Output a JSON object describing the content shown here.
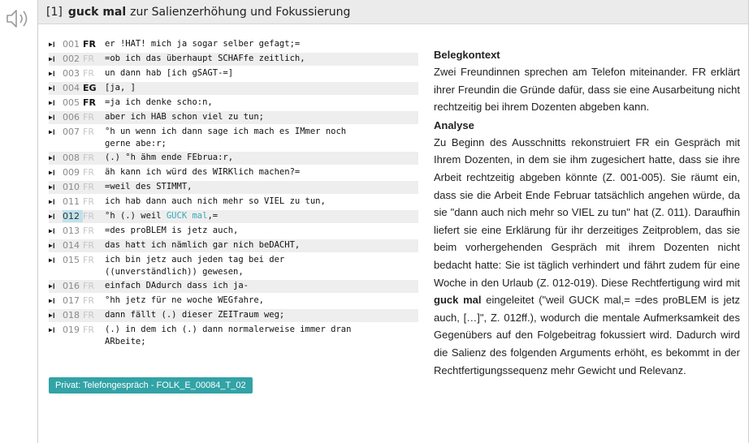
{
  "header": {
    "number": "[1]",
    "phrase": "guck mal",
    "title": "zur Salienzerhöhung und Fokussierung"
  },
  "transcript": [
    {
      "num": "001",
      "speaker": "FR",
      "strong": true,
      "text": "er !HAT! mich ja sogar selber gefagt;=",
      "alt": false
    },
    {
      "num": "002",
      "speaker": "FR",
      "strong": false,
      "text": "=ob ich das überhaupt SCHAFfe zeitlich,",
      "alt": true
    },
    {
      "num": "003",
      "speaker": "FR",
      "strong": false,
      "text": "un dann hab [ich gSAGT-=]",
      "alt": false
    },
    {
      "num": "004",
      "speaker": "EG",
      "strong": true,
      "text": "[ja, ]",
      "alt": true
    },
    {
      "num": "005",
      "speaker": "FR",
      "strong": true,
      "text": "=ja ich denke scho:n,",
      "alt": false
    },
    {
      "num": "006",
      "speaker": "FR",
      "strong": false,
      "text": "aber ich HAB schon viel zu tun;",
      "alt": true
    },
    {
      "num": "007",
      "speaker": "FR",
      "strong": false,
      "text": "°h un wenn ich dann sage ich mach es IMmer noch\ngerne abe:r;",
      "alt": false
    },
    {
      "num": "008",
      "speaker": "FR",
      "strong": false,
      "text": "(.) °h ähm ende FEbrua:r,",
      "alt": true
    },
    {
      "num": "009",
      "speaker": "FR",
      "strong": false,
      "text": "äh kann ich würd des WIRKlich machen?=",
      "alt": false
    },
    {
      "num": "010",
      "speaker": "FR",
      "strong": false,
      "text": "=weil des STIMMT,",
      "alt": true
    },
    {
      "num": "011",
      "speaker": "FR",
      "strong": false,
      "text": "ich hab dann auch nich mehr so VIEL zu tun,",
      "alt": false
    },
    {
      "num": "012",
      "speaker": "FR",
      "strong": false,
      "text": "°h (.) weil ",
      "mark": "GUCK mal",
      "after": ",=",
      "alt": true,
      "highlight": true
    },
    {
      "num": "013",
      "speaker": "FR",
      "strong": false,
      "text": "=des proBLEM is jetz auch,",
      "alt": false
    },
    {
      "num": "014",
      "speaker": "FR",
      "strong": false,
      "text": "das hatt ich nämlich gar nich beDACHT,",
      "alt": true
    },
    {
      "num": "015",
      "speaker": "FR",
      "strong": false,
      "text": "ich bin jetz auch jeden tag bei der\n((unverständlich)) gewesen,",
      "alt": false
    },
    {
      "num": "016",
      "speaker": "FR",
      "strong": false,
      "text": "einfach DAdurch dass ich ja-",
      "alt": true
    },
    {
      "num": "017",
      "speaker": "FR",
      "strong": false,
      "text": "°hh jetz für ne woche WEGfahre,",
      "alt": false
    },
    {
      "num": "018",
      "speaker": "FR",
      "strong": false,
      "text": "dann fällt (.) dieser ZEITraum weg;",
      "alt": true
    },
    {
      "num": "019",
      "speaker": "FR",
      "strong": false,
      "text": "(.) in dem ich (.) dann normalerweise immer dran\nARbeite;",
      "alt": false
    }
  ],
  "badge": "Privat: Telefongespräch - FOLK_E_00084_T_02",
  "belegkontext": {
    "heading": "Belegkontext",
    "text": "Zwei Freundinnen sprechen am Telefon miteinander. FR erklärt ihrer Freundin die Gründe dafür, dass sie eine Ausarbeitung nicht rechtzeitig bei ihrem Dozenten abgeben kann."
  },
  "analyse": {
    "heading": "Analyse",
    "text_before": "Zu Beginn des Ausschnitts rekonstruiert FR ein Gespräch mit Ihrem Dozenten, in dem sie ihm zugesichert hatte, dass sie ihre Arbeit rechtzeitig abgeben könnte (Z. 001-005). Sie räumt ein, dass sie die Arbeit Ende Februar tatsächlich angehen würde, da sie \"dann auch nich mehr so VIEL zu tun\" hat (Z. 011). Daraufhin liefert sie eine Erklärung für ihr derzeitiges Zeitproblem, das sie beim vorhergehenden Gespräch mit ihrem Dozenten nicht bedacht hatte: Sie ist täglich verhindert und fährt zudem für eine Woche in den Urlaub (Z. 012-019). Diese Rechtfertigung wird mit ",
    "bold_phrase": "guck mal",
    "text_after": " eingeleitet (\"weil GUCK mal,= =des proBLEM is jetz auch, […]\", Z. 012ff.), wodurch die mentale Aufmerksamkeit des Gegenübers auf den Folgebeitrag fokussiert wird. Dadurch wird die Salienz des folgenden Arguments erhöht, es bekommt in der Rechtfertigungssequenz mehr Gewicht und Relevanz."
  },
  "icons": {
    "speaker": "speaker-icon",
    "play": "play-pause-icon"
  },
  "colors": {
    "accent": "#32a3a6",
    "highlight": "#bfe2ea",
    "mark": "#3aa6b9"
  }
}
